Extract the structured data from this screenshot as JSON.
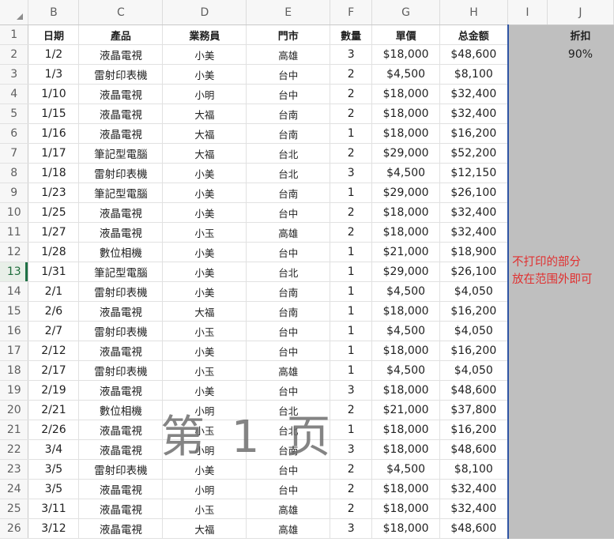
{
  "sheet": {
    "corner_icon": "select-all-triangle-icon",
    "columns": [
      "B",
      "C",
      "D",
      "E",
      "F",
      "G",
      "H",
      "I",
      "J"
    ],
    "header_row": {
      "row": "1",
      "cells": [
        "日期",
        "產品",
        "業務員",
        "門市",
        "數量",
        "單價",
        "总金额",
        "",
        "折扣"
      ]
    },
    "discount_value": "90%",
    "rows": [
      {
        "row": "2",
        "cells": [
          "1/2",
          "液晶電視",
          "小美",
          "高雄",
          "3",
          "$18,000",
          "$48,600"
        ]
      },
      {
        "row": "3",
        "cells": [
          "1/3",
          "雷射印表機",
          "小美",
          "台中",
          "2",
          "$4,500",
          "$8,100"
        ]
      },
      {
        "row": "4",
        "cells": [
          "1/10",
          "液晶電視",
          "小明",
          "台中",
          "2",
          "$18,000",
          "$32,400"
        ]
      },
      {
        "row": "5",
        "cells": [
          "1/15",
          "液晶電視",
          "大福",
          "台南",
          "2",
          "$18,000",
          "$32,400"
        ]
      },
      {
        "row": "6",
        "cells": [
          "1/16",
          "液晶電視",
          "大福",
          "台南",
          "1",
          "$18,000",
          "$16,200"
        ]
      },
      {
        "row": "7",
        "cells": [
          "1/17",
          "筆記型電腦",
          "大福",
          "台北",
          "2",
          "$29,000",
          "$52,200"
        ]
      },
      {
        "row": "8",
        "cells": [
          "1/18",
          "雷射印表機",
          "小美",
          "台北",
          "3",
          "$4,500",
          "$12,150"
        ]
      },
      {
        "row": "9",
        "cells": [
          "1/23",
          "筆記型電腦",
          "小美",
          "台南",
          "1",
          "$29,000",
          "$26,100"
        ]
      },
      {
        "row": "10",
        "cells": [
          "1/25",
          "液晶電視",
          "小美",
          "台中",
          "2",
          "$18,000",
          "$32,400"
        ]
      },
      {
        "row": "11",
        "cells": [
          "1/27",
          "液晶電視",
          "小玉",
          "高雄",
          "2",
          "$18,000",
          "$32,400"
        ]
      },
      {
        "row": "12",
        "cells": [
          "1/28",
          "數位相機",
          "小美",
          "台中",
          "1",
          "$21,000",
          "$18,900"
        ]
      },
      {
        "row": "13",
        "cells": [
          "1/31",
          "筆記型電腦",
          "小美",
          "台北",
          "1",
          "$29,000",
          "$26,100"
        ]
      },
      {
        "row": "14",
        "cells": [
          "2/1",
          "雷射印表機",
          "小美",
          "台南",
          "1",
          "$4,500",
          "$4,050"
        ]
      },
      {
        "row": "15",
        "cells": [
          "2/6",
          "液晶電視",
          "大福",
          "台南",
          "1",
          "$18,000",
          "$16,200"
        ]
      },
      {
        "row": "16",
        "cells": [
          "2/7",
          "雷射印表機",
          "小玉",
          "台中",
          "1",
          "$4,500",
          "$4,050"
        ]
      },
      {
        "row": "17",
        "cells": [
          "2/12",
          "液晶電視",
          "小美",
          "台中",
          "1",
          "$18,000",
          "$16,200"
        ]
      },
      {
        "row": "18",
        "cells": [
          "2/17",
          "雷射印表機",
          "小玉",
          "高雄",
          "1",
          "$4,500",
          "$4,050"
        ]
      },
      {
        "row": "19",
        "cells": [
          "2/19",
          "液晶電視",
          "小美",
          "台中",
          "3",
          "$18,000",
          "$48,600"
        ]
      },
      {
        "row": "20",
        "cells": [
          "2/21",
          "數位相機",
          "小明",
          "台北",
          "2",
          "$21,000",
          "$37,800"
        ]
      },
      {
        "row": "21",
        "cells": [
          "2/26",
          "液晶電視",
          "小玉",
          "台北",
          "1",
          "$18,000",
          "$16,200"
        ]
      },
      {
        "row": "22",
        "cells": [
          "3/4",
          "液晶電視",
          "小明",
          "台南",
          "3",
          "$18,000",
          "$48,600"
        ]
      },
      {
        "row": "23",
        "cells": [
          "3/5",
          "雷射印表機",
          "小美",
          "台中",
          "2",
          "$4,500",
          "$8,100"
        ]
      },
      {
        "row": "24",
        "cells": [
          "3/5",
          "液晶電視",
          "小明",
          "台中",
          "2",
          "$18,000",
          "$32,400"
        ]
      },
      {
        "row": "25",
        "cells": [
          "3/11",
          "液晶電視",
          "小玉",
          "高雄",
          "2",
          "$18,000",
          "$32,400"
        ]
      },
      {
        "row": "26",
        "cells": [
          "3/12",
          "液晶電視",
          "大福",
          "高雄",
          "3",
          "$18,000",
          "$48,600"
        ]
      }
    ],
    "selected_row": "13"
  },
  "page_watermark": "第 1 页",
  "annotation": {
    "line1": "不打印的部分",
    "line2": "放在范围外即可"
  },
  "colors": {
    "print_area_border": "#2f55a4",
    "outside_print_area": "#bfbfbf",
    "note_text": "#e03030",
    "selected_row_accent": "#1e7145"
  }
}
